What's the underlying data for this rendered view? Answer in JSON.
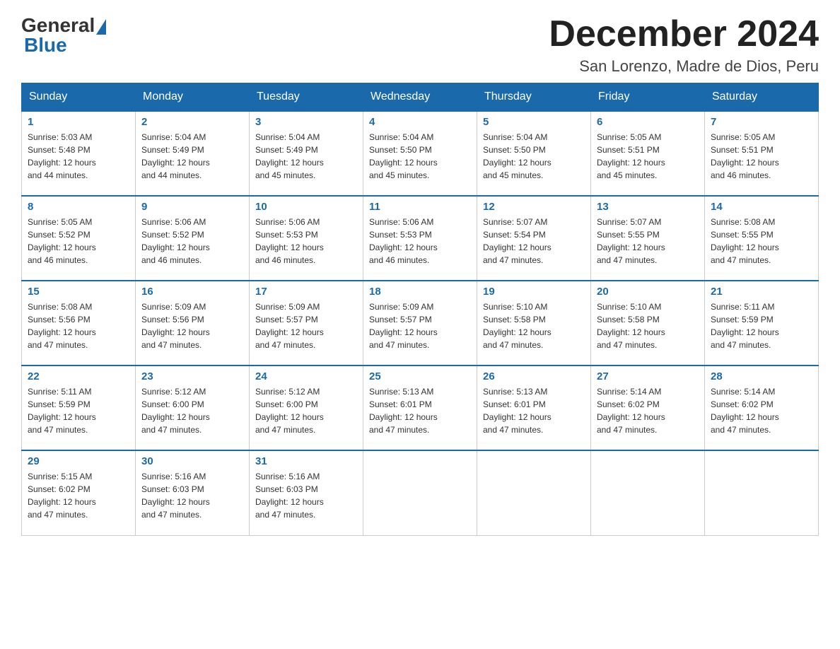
{
  "header": {
    "logo_general": "General",
    "logo_blue": "Blue",
    "month_title": "December 2024",
    "subtitle": "San Lorenzo, Madre de Dios, Peru"
  },
  "days_of_week": [
    "Sunday",
    "Monday",
    "Tuesday",
    "Wednesday",
    "Thursday",
    "Friday",
    "Saturday"
  ],
  "weeks": [
    [
      {
        "day": 1,
        "sunrise": "5:03 AM",
        "sunset": "5:48 PM",
        "daylight": "12 hours and 44 minutes."
      },
      {
        "day": 2,
        "sunrise": "5:04 AM",
        "sunset": "5:49 PM",
        "daylight": "12 hours and 44 minutes."
      },
      {
        "day": 3,
        "sunrise": "5:04 AM",
        "sunset": "5:49 PM",
        "daylight": "12 hours and 45 minutes."
      },
      {
        "day": 4,
        "sunrise": "5:04 AM",
        "sunset": "5:50 PM",
        "daylight": "12 hours and 45 minutes."
      },
      {
        "day": 5,
        "sunrise": "5:04 AM",
        "sunset": "5:50 PM",
        "daylight": "12 hours and 45 minutes."
      },
      {
        "day": 6,
        "sunrise": "5:05 AM",
        "sunset": "5:51 PM",
        "daylight": "12 hours and 45 minutes."
      },
      {
        "day": 7,
        "sunrise": "5:05 AM",
        "sunset": "5:51 PM",
        "daylight": "12 hours and 46 minutes."
      }
    ],
    [
      {
        "day": 8,
        "sunrise": "5:05 AM",
        "sunset": "5:52 PM",
        "daylight": "12 hours and 46 minutes."
      },
      {
        "day": 9,
        "sunrise": "5:06 AM",
        "sunset": "5:52 PM",
        "daylight": "12 hours and 46 minutes."
      },
      {
        "day": 10,
        "sunrise": "5:06 AM",
        "sunset": "5:53 PM",
        "daylight": "12 hours and 46 minutes."
      },
      {
        "day": 11,
        "sunrise": "5:06 AM",
        "sunset": "5:53 PM",
        "daylight": "12 hours and 46 minutes."
      },
      {
        "day": 12,
        "sunrise": "5:07 AM",
        "sunset": "5:54 PM",
        "daylight": "12 hours and 47 minutes."
      },
      {
        "day": 13,
        "sunrise": "5:07 AM",
        "sunset": "5:55 PM",
        "daylight": "12 hours and 47 minutes."
      },
      {
        "day": 14,
        "sunrise": "5:08 AM",
        "sunset": "5:55 PM",
        "daylight": "12 hours and 47 minutes."
      }
    ],
    [
      {
        "day": 15,
        "sunrise": "5:08 AM",
        "sunset": "5:56 PM",
        "daylight": "12 hours and 47 minutes."
      },
      {
        "day": 16,
        "sunrise": "5:09 AM",
        "sunset": "5:56 PM",
        "daylight": "12 hours and 47 minutes."
      },
      {
        "day": 17,
        "sunrise": "5:09 AM",
        "sunset": "5:57 PM",
        "daylight": "12 hours and 47 minutes."
      },
      {
        "day": 18,
        "sunrise": "5:09 AM",
        "sunset": "5:57 PM",
        "daylight": "12 hours and 47 minutes."
      },
      {
        "day": 19,
        "sunrise": "5:10 AM",
        "sunset": "5:58 PM",
        "daylight": "12 hours and 47 minutes."
      },
      {
        "day": 20,
        "sunrise": "5:10 AM",
        "sunset": "5:58 PM",
        "daylight": "12 hours and 47 minutes."
      },
      {
        "day": 21,
        "sunrise": "5:11 AM",
        "sunset": "5:59 PM",
        "daylight": "12 hours and 47 minutes."
      }
    ],
    [
      {
        "day": 22,
        "sunrise": "5:11 AM",
        "sunset": "5:59 PM",
        "daylight": "12 hours and 47 minutes."
      },
      {
        "day": 23,
        "sunrise": "5:12 AM",
        "sunset": "6:00 PM",
        "daylight": "12 hours and 47 minutes."
      },
      {
        "day": 24,
        "sunrise": "5:12 AM",
        "sunset": "6:00 PM",
        "daylight": "12 hours and 47 minutes."
      },
      {
        "day": 25,
        "sunrise": "5:13 AM",
        "sunset": "6:01 PM",
        "daylight": "12 hours and 47 minutes."
      },
      {
        "day": 26,
        "sunrise": "5:13 AM",
        "sunset": "6:01 PM",
        "daylight": "12 hours and 47 minutes."
      },
      {
        "day": 27,
        "sunrise": "5:14 AM",
        "sunset": "6:02 PM",
        "daylight": "12 hours and 47 minutes."
      },
      {
        "day": 28,
        "sunrise": "5:14 AM",
        "sunset": "6:02 PM",
        "daylight": "12 hours and 47 minutes."
      }
    ],
    [
      {
        "day": 29,
        "sunrise": "5:15 AM",
        "sunset": "6:02 PM",
        "daylight": "12 hours and 47 minutes."
      },
      {
        "day": 30,
        "sunrise": "5:16 AM",
        "sunset": "6:03 PM",
        "daylight": "12 hours and 47 minutes."
      },
      {
        "day": 31,
        "sunrise": "5:16 AM",
        "sunset": "6:03 PM",
        "daylight": "12 hours and 47 minutes."
      },
      null,
      null,
      null,
      null
    ]
  ]
}
